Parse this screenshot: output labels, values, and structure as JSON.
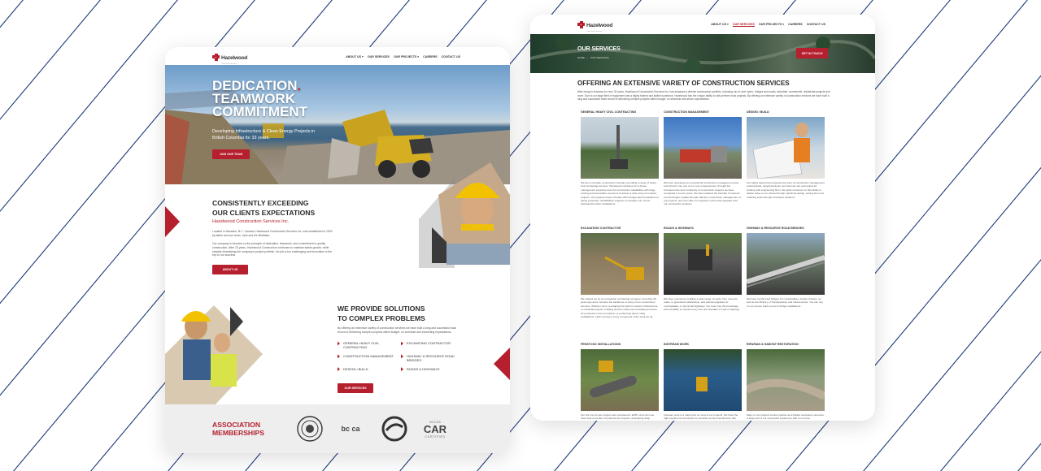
{
  "colors": {
    "brand_red": "#b51f2e",
    "accent_red": "#e31c2d",
    "line_blue": "#1c3a7a",
    "assoc_bg": "#eeeeee"
  },
  "left_page": {
    "logo": {
      "name": "Hazelwood",
      "tagline": "Construction Services"
    },
    "nav": [
      {
        "label": "ABOUT US",
        "dropdown": true
      },
      {
        "label": "OUR SERVICES",
        "dropdown": false
      },
      {
        "label": "OUR PROJECTS",
        "dropdown": true
      },
      {
        "label": "CAREERS",
        "dropdown": false
      },
      {
        "label": "CONTACT US",
        "dropdown": false
      }
    ],
    "hero": {
      "title_lines": [
        "DEDICATION",
        "TEAMWORK",
        "COMMITMENT"
      ],
      "title_dot": ".",
      "subtitle": "Developing Infrastructure & Clean Energy Projects in British Columbia for 33 years.",
      "button": "JOIN OUR TEAM"
    },
    "about": {
      "title_line1": "CONSISTENTLY EXCEEDING",
      "title_line2": "OUR CLIENTS EXPECTATIONS",
      "subtitle": "Hazelwood Construction Services Inc.",
      "para1": "Located in Nanaimo, B.C. Canada, Hazelwood Construction Services Inc. was established in 1993 by father and son team, Jack and Ed Whittaker.",
      "para2": "Our company is founded on the principle of dedication, teamwork, and commitment to quality construction. After 22 years, Hazelwood Construction continues to maintain stable growth, while steadily diversifying the company's project portfolio. No job is too challenging and innovation is the key to our success.",
      "button": "ABOUT US"
    },
    "solutions": {
      "title_line1": "WE PROVIDE SOLUTIONS",
      "title_line2": "TO COMPLEX PROBLEMS",
      "para": "By offering an extensive variety of construction services we have built a long and successful track record of delivering complex projects within budget, on schedule and exceeding expectations.",
      "items": [
        "GENERAL HEAVY CIVIL CONTRACTING",
        "EXCAVATING CONTRACTOR",
        "CONSTRUCTION MANAGEMENT",
        "HIGHWAY & RESOURCE ROAD BRIDGES",
        "DESIGN / BUILD",
        "ROADS & HIGHWAYS"
      ],
      "button": "OUR SERVICES"
    },
    "associations": {
      "title_line1": "ASSOCIATION",
      "title_line2": "MEMBERSHIPS",
      "logos": [
        {
          "name": "seal-logo",
          "text": ""
        },
        {
          "name": "bcca-logo",
          "text": "bc ca"
        },
        {
          "name": "vica-logo",
          "text": ""
        },
        {
          "name": "cor-logo",
          "text": "CAR",
          "caption_top": "BCCSA",
          "caption_bottom": "CERTIFIED"
        }
      ]
    }
  },
  "right_page": {
    "logo": {
      "name": "Hazelwood",
      "tagline": "Construction Services"
    },
    "nav": [
      {
        "label": "ABOUT US",
        "dropdown": true
      },
      {
        "label": "OUR SERVICES",
        "dropdown": false,
        "active": true
      },
      {
        "label": "OUR PROJECTS",
        "dropdown": true
      },
      {
        "label": "CAREERS",
        "dropdown": false
      },
      {
        "label": "CONTACT US",
        "dropdown": false
      }
    ],
    "banner": {
      "title": "OUR SERVICES",
      "breadcrumb": [
        "HOME",
        "OUR SERVICES"
      ],
      "button": "GET IN TOUCH"
    },
    "offer": {
      "title": "OFFERING AN EXTENSIVE VARIETY OF CONSTRUCTION SERVICES",
      "para": "After being in business for over 32 years, Hazelwood Construction Services Inc. has amassed a diverse construction portfolio, including run-of-river hydro, bridges and roads, industrial, commercial, residential projects and more. Due to our large fleet of equipment and a highly trained and skilled workforce, Hazelwood has the unique ability to self-perform most projects. By offering an extensive variety of construction services we have built a long and successful track record of delivering complex projects within budget, on schedule and above expectations."
    },
    "services": [
      {
        "title": "GENERAL HEAVY CIVIL CONTRACTING",
        "text": "We are a versatile construction company providing a range of heavy civil contracting services. Hazelwood combines its in-house management expertise and civil construction capabilities with large existing and accessible resources to deliver a wide array of complex projects. Our projects scope includes LRN storage tank foundations to piping protected, rehabilitation projects to complete run of river hydroelectric plant installations."
      },
      {
        "title": "CONSTRUCTION MANAGEMENT",
        "text": "We have developed an exceptional construction management team and turned it into one of our core competencies, through the increased size and complexity of construction projects we have completed in recent years. We have realized the benefits of reduced cost and higher quality through effective construction management on our projects, and now offer our expertise in this area separate from our construction program."
      },
      {
        "title": "DESIGN / BUILD",
        "text": "Our highly trained and experienced team of construction management professionals, superintendents, and foremen are well-suited for working with engineering firms. We pride ourselves on this ability to deliver value to our clients through optimized design, saving time and reducing costs through innovative solutions."
      },
      {
        "title": "EXCAVATING CONTRACTOR",
        "text": "We started out as an excavation contracting company more than 20 years ago and it remains the backbone of many of our construction services. Whether we're re-shaping the land for various infrastructure or industrial projects, building access roads and excavating trenches for penstocks in the mountains, or performing above utility installations, earth moving is a key component of the work we do."
      },
      {
        "title": "ROADS & HIGHWAYS",
        "text": "We have experience building a wide range of roads, from resource roads, to greenfield subdivisions, and arterial upgrades for municipalities, to provincial highways. Our team has the knowledge and versatility to construct any size and standard of road or highway."
      },
      {
        "title": "HIGHWAY & RESOURCE ROAD BRIDGES",
        "text": "We have constructed bridges for municipalities, private industry, as well as the Ministry of Transportation and Infrastructure. You can rely on our proven track record of bridge installations."
      },
      {
        "title": "PENSTOCK INSTALLATIONS",
        "text": "Our first run-of-river project was completed in 2005; since then we have built a number of hydroelectric projects, developing deep expertise installing penstock pipe of diverse diameters and materials."
      },
      {
        "title": "INSTREAM WORK",
        "text": "Instream work is a major part on most of our projects. We have the right equipment and people for sensitive environmental work. We always work closely with project environmental monitors."
      },
      {
        "title": "RIPARIAN & HABITAT RESTORATION",
        "text": "Many of our projects involve riparian and habitat restoration elements. A large part of our successful experience with run-of-river hydroelectric projects, a variety of environmentally sensitive works."
      }
    ]
  }
}
